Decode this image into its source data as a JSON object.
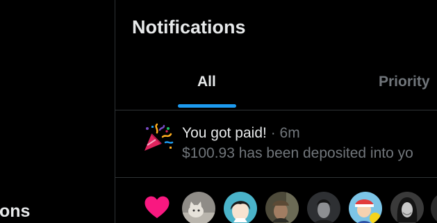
{
  "sidebar": {
    "partial_label": "ons"
  },
  "header": {
    "title": "Notifications"
  },
  "tabs": [
    {
      "label": "All",
      "selected": true
    },
    {
      "label": "Priority",
      "selected": false
    }
  ],
  "colors": {
    "accent": "#1d9bf0",
    "like": "#f91880",
    "text_primary": "#e7e9ea",
    "text_secondary": "#71767b",
    "border": "#2f3336"
  },
  "notifications": [
    {
      "icon": "party-popper-icon",
      "title": "You got paid!",
      "separator": "·",
      "time": "6m",
      "body": "$100.93 has been deposited into yo"
    },
    {
      "icon": "heart-icon",
      "avatars": [
        "avatar-cat",
        "avatar-anime-character",
        "avatar-man-cap",
        "avatar-man-dark",
        "avatar-pikachu-trainer",
        "avatar-woman",
        "avatar-partial"
      ]
    }
  ]
}
